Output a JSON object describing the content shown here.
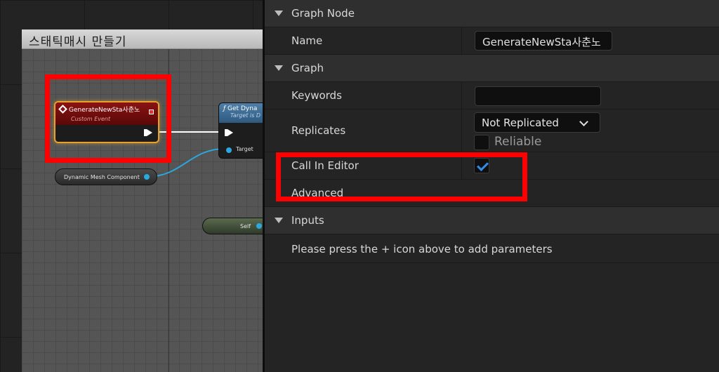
{
  "graph": {
    "comment_title": "스태틱매시 만들기",
    "event_node": {
      "title": "GenerateNewSta사춘노",
      "subtitle": "Custom Event",
      "icon": "custom-event-icon"
    },
    "function_node": {
      "title": "Get Dyna",
      "subtitle": "Target is D",
      "pin_label": "Target"
    },
    "variable_nodes": {
      "dynamic_mesh": "Dynamic Mesh Component",
      "self": "Self"
    }
  },
  "details": {
    "graph_node_section": {
      "title": "Graph Node",
      "name_label": "Name",
      "name_value": "GenerateNewSta사춘노"
    },
    "graph_section": {
      "title": "Graph",
      "keywords_label": "Keywords",
      "keywords_value": "",
      "replicates_label": "Replicates",
      "replicates_value": "Not Replicated",
      "reliable_label": "Reliable",
      "reliable_checked": false,
      "call_in_editor_label": "Call In Editor",
      "call_in_editor_checked": true,
      "advanced_label": "Advanced"
    },
    "inputs_section": {
      "title": "Inputs",
      "message": "Please press the + icon above to add parameters"
    }
  },
  "colors": {
    "highlight": "#ff0000",
    "event_header": "#8a1313",
    "function_header": "#4f7fa8",
    "checkbox_accent": "#2f8eea",
    "pin_blue": "#2ca8e0"
  }
}
